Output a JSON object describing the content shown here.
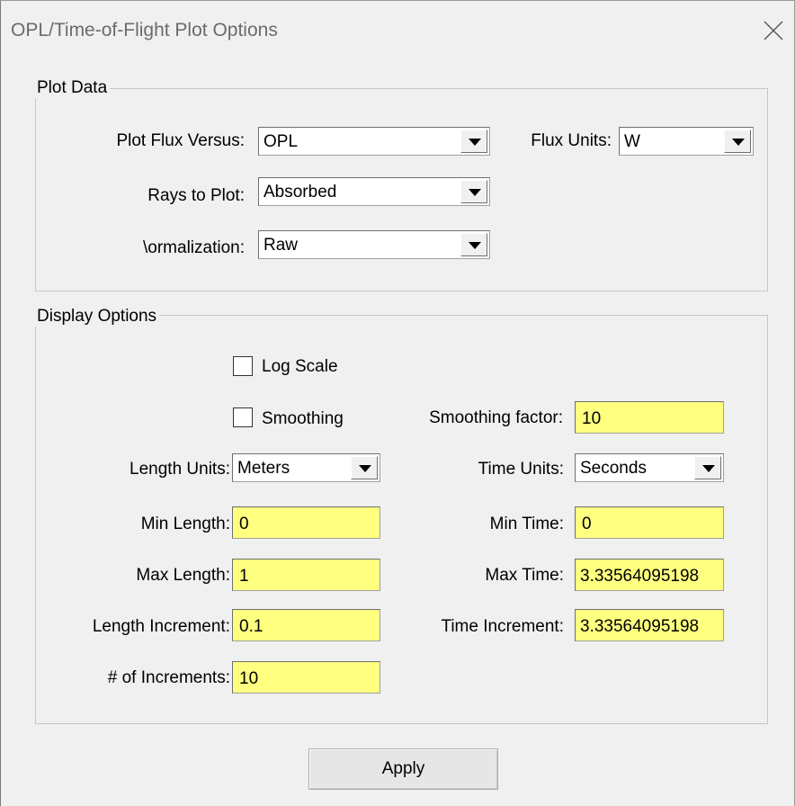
{
  "window": {
    "title": "OPL/Time-of-Flight Plot Options",
    "close_icon": "close-icon"
  },
  "plot_data": {
    "legend": "Plot Data",
    "plot_flux_versus": {
      "label": "Plot Flux Versus:",
      "value": "OPL"
    },
    "flux_units": {
      "label": "Flux Units:",
      "value": "W"
    },
    "rays_to_plot": {
      "label": "Rays to Plot:",
      "value": "Absorbed"
    },
    "normalization": {
      "label": "\\ormalization:",
      "value": "Raw"
    }
  },
  "display_options": {
    "legend": "Display Options",
    "log_scale": {
      "label": "Log Scale",
      "checked": false
    },
    "smoothing": {
      "label": "Smoothing",
      "checked": false
    },
    "smoothing_factor": {
      "label": "Smoothing factor:",
      "value": "10"
    },
    "length_units": {
      "label": "Length Units:",
      "value": "Meters"
    },
    "time_units": {
      "label": "Time Units:",
      "value": "Seconds"
    },
    "min_length": {
      "label": "Min Length:",
      "value": "0"
    },
    "min_time": {
      "label": "Min Time:",
      "value": "0"
    },
    "max_length": {
      "label": "Max Length:",
      "value": "1"
    },
    "max_time": {
      "label": "Max Time:",
      "value": "3.33564095198"
    },
    "length_increment": {
      "label": "Length Increment:",
      "value": "0.1"
    },
    "time_increment": {
      "label": "Time Increment:",
      "value": "3.33564095198"
    },
    "num_increments": {
      "label": "# of Increments:",
      "value": "10"
    }
  },
  "apply_button": {
    "label": "Apply"
  },
  "colors": {
    "background": "#f0f0f0",
    "editable_field": "#ffff80",
    "title_text": "#6b6b6b"
  }
}
